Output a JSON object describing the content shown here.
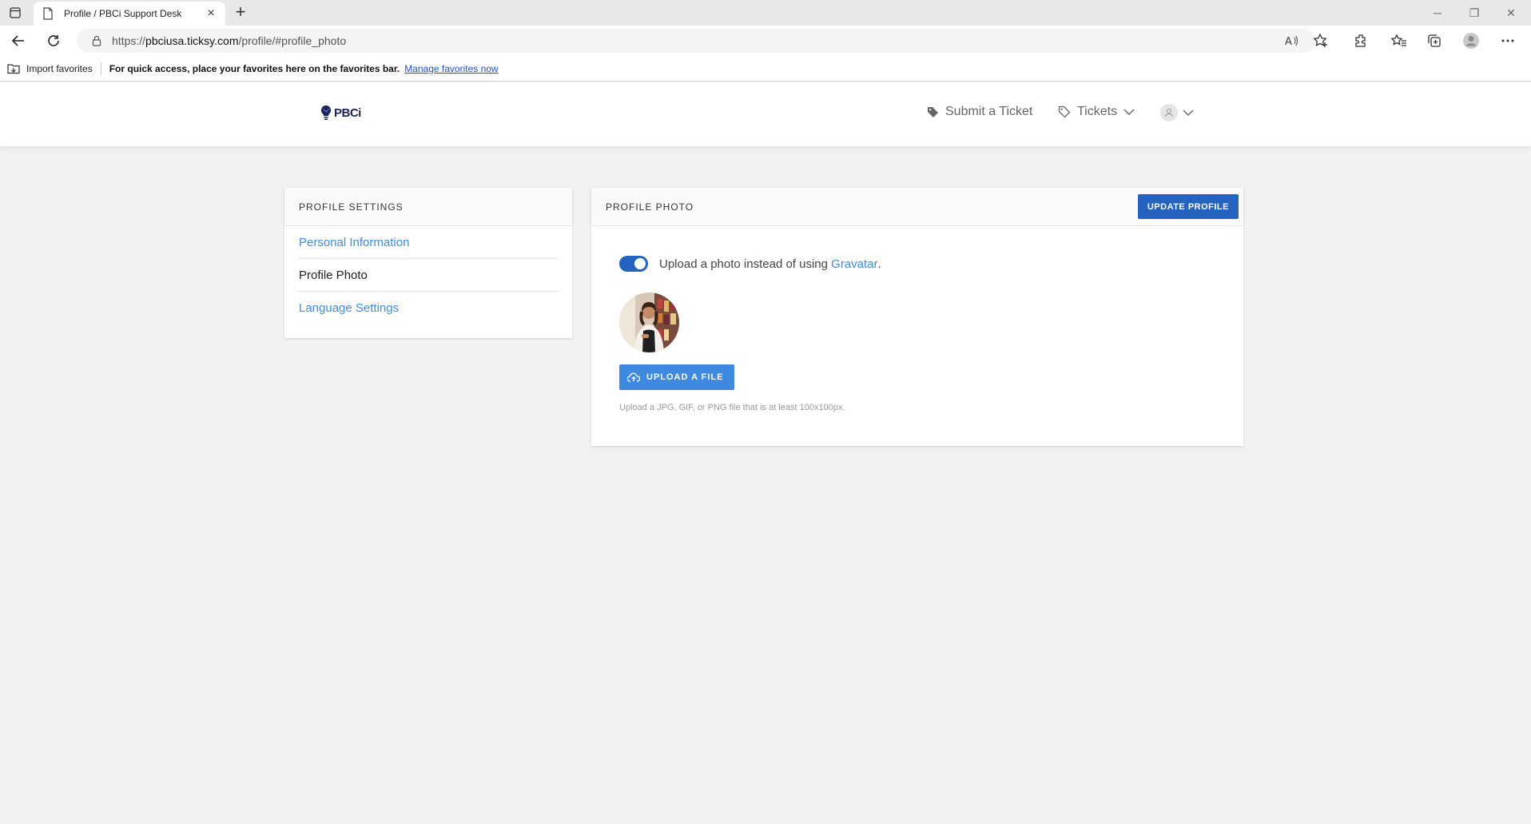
{
  "browser": {
    "tab_title": "Profile / PBCi Support Desk",
    "url_prefix": "https://",
    "url_host": "pbciusa.ticksy.com",
    "url_path": "/profile/#profile_photo"
  },
  "favorites_bar": {
    "import_label": "Import favorites",
    "hint": "For quick access, place your favorites here on the favorites bar.",
    "manage_link": "Manage favorites now"
  },
  "header": {
    "logo_text": "PBCi",
    "submit_ticket": "Submit a Ticket",
    "tickets": "Tickets"
  },
  "sidebar": {
    "title": "PROFILE SETTINGS",
    "items": [
      {
        "label": "Personal Information",
        "active": false
      },
      {
        "label": "Profile Photo",
        "active": true
      },
      {
        "label": "Language Settings",
        "active": false
      }
    ]
  },
  "main": {
    "title": "PROFILE PHOTO",
    "update_button": "UPDATE PROFILE",
    "toggle_text": "Upload a photo instead of using ",
    "toggle_link": "Gravatar",
    "toggle_suffix": ".",
    "toggle_on": true,
    "upload_button": "UPLOAD A FILE",
    "upload_hint": "Upload a JPG, GIF, or PNG file that is at least 100x100px."
  },
  "colors": {
    "primary": "#2563c0",
    "link": "#3f8ae0",
    "page_bg": "#f1f1f1"
  }
}
